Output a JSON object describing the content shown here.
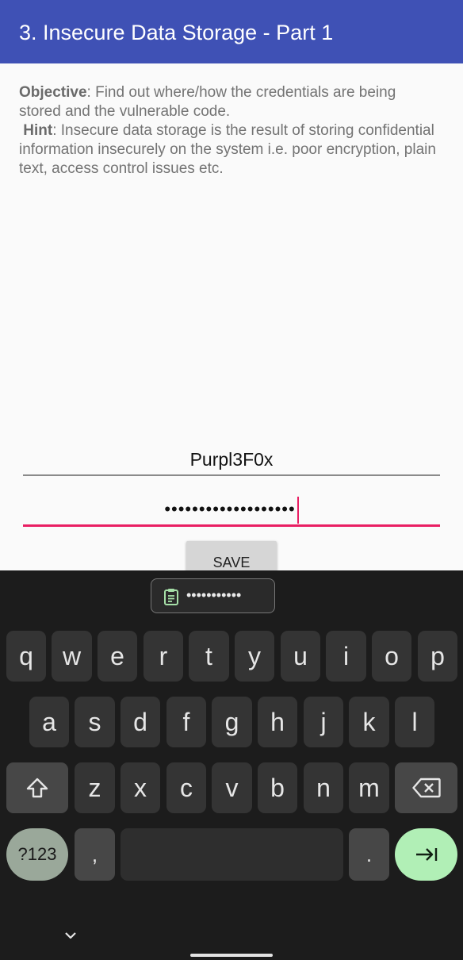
{
  "app_bar": {
    "title": "3. Insecure Data Storage - Part 1"
  },
  "content": {
    "objective_label": "Objective",
    "objective_text": ": Find out where/how the credentials are being stored and the vulnerable code.",
    "hint_label": "Hint",
    "hint_text": ": Insecure data storage is the result of storing confidential information insecurely on the system i.e. poor encryption, plain text, access control issues etc."
  },
  "form": {
    "username_value": "Purpl3F0x",
    "password_mask": "•••••••••••••••••••",
    "save_label": "SAVE"
  },
  "keyboard": {
    "suggestion_mask": "•••••••••••",
    "row1": [
      "q",
      "w",
      "e",
      "r",
      "t",
      "y",
      "u",
      "i",
      "o",
      "p"
    ],
    "row2": [
      "a",
      "s",
      "d",
      "f",
      "g",
      "h",
      "j",
      "k",
      "l"
    ],
    "row3": [
      "z",
      "x",
      "c",
      "v",
      "b",
      "n",
      "m"
    ],
    "mode_label": "?123",
    "comma": ",",
    "period": "."
  },
  "colors": {
    "app_bar": "#3f51b5",
    "accent": "#e91e63",
    "action_key": "#b1efb6"
  }
}
